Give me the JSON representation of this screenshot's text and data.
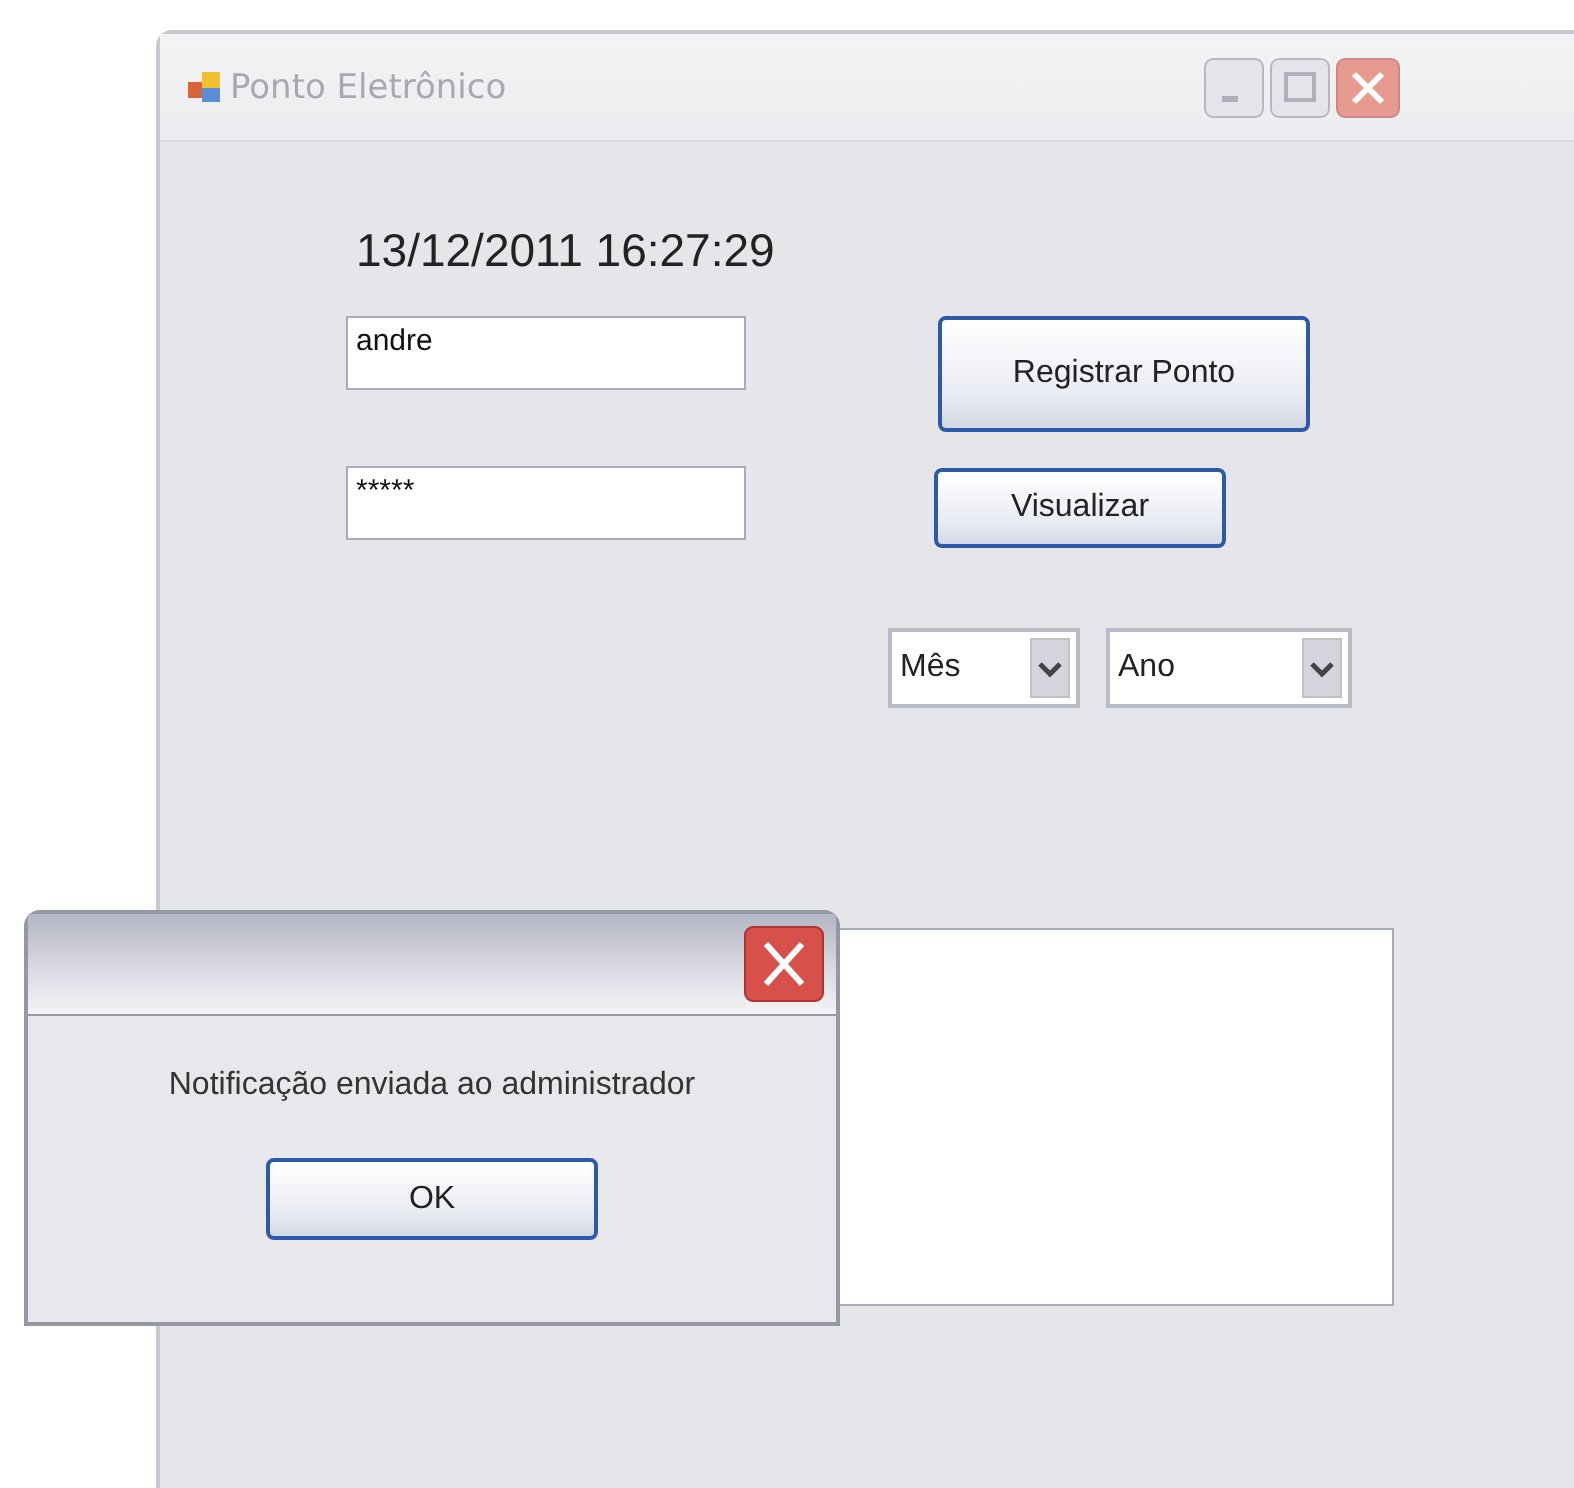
{
  "window": {
    "title": "Ponto Eletrônico",
    "active": false
  },
  "clock": "13/12/2011 16:27:29",
  "fields": [
    {
      "value": "andre"
    },
    {
      "value": "*****"
    }
  ],
  "buttons": [
    "Registrar Ponto",
    "Visualizar"
  ],
  "dropdowns": [
    {
      "value": "Mês"
    },
    {
      "value": "Ano"
    }
  ],
  "dialog": {
    "message": "Notificação enviada ao administrador",
    "button": "OK"
  }
}
